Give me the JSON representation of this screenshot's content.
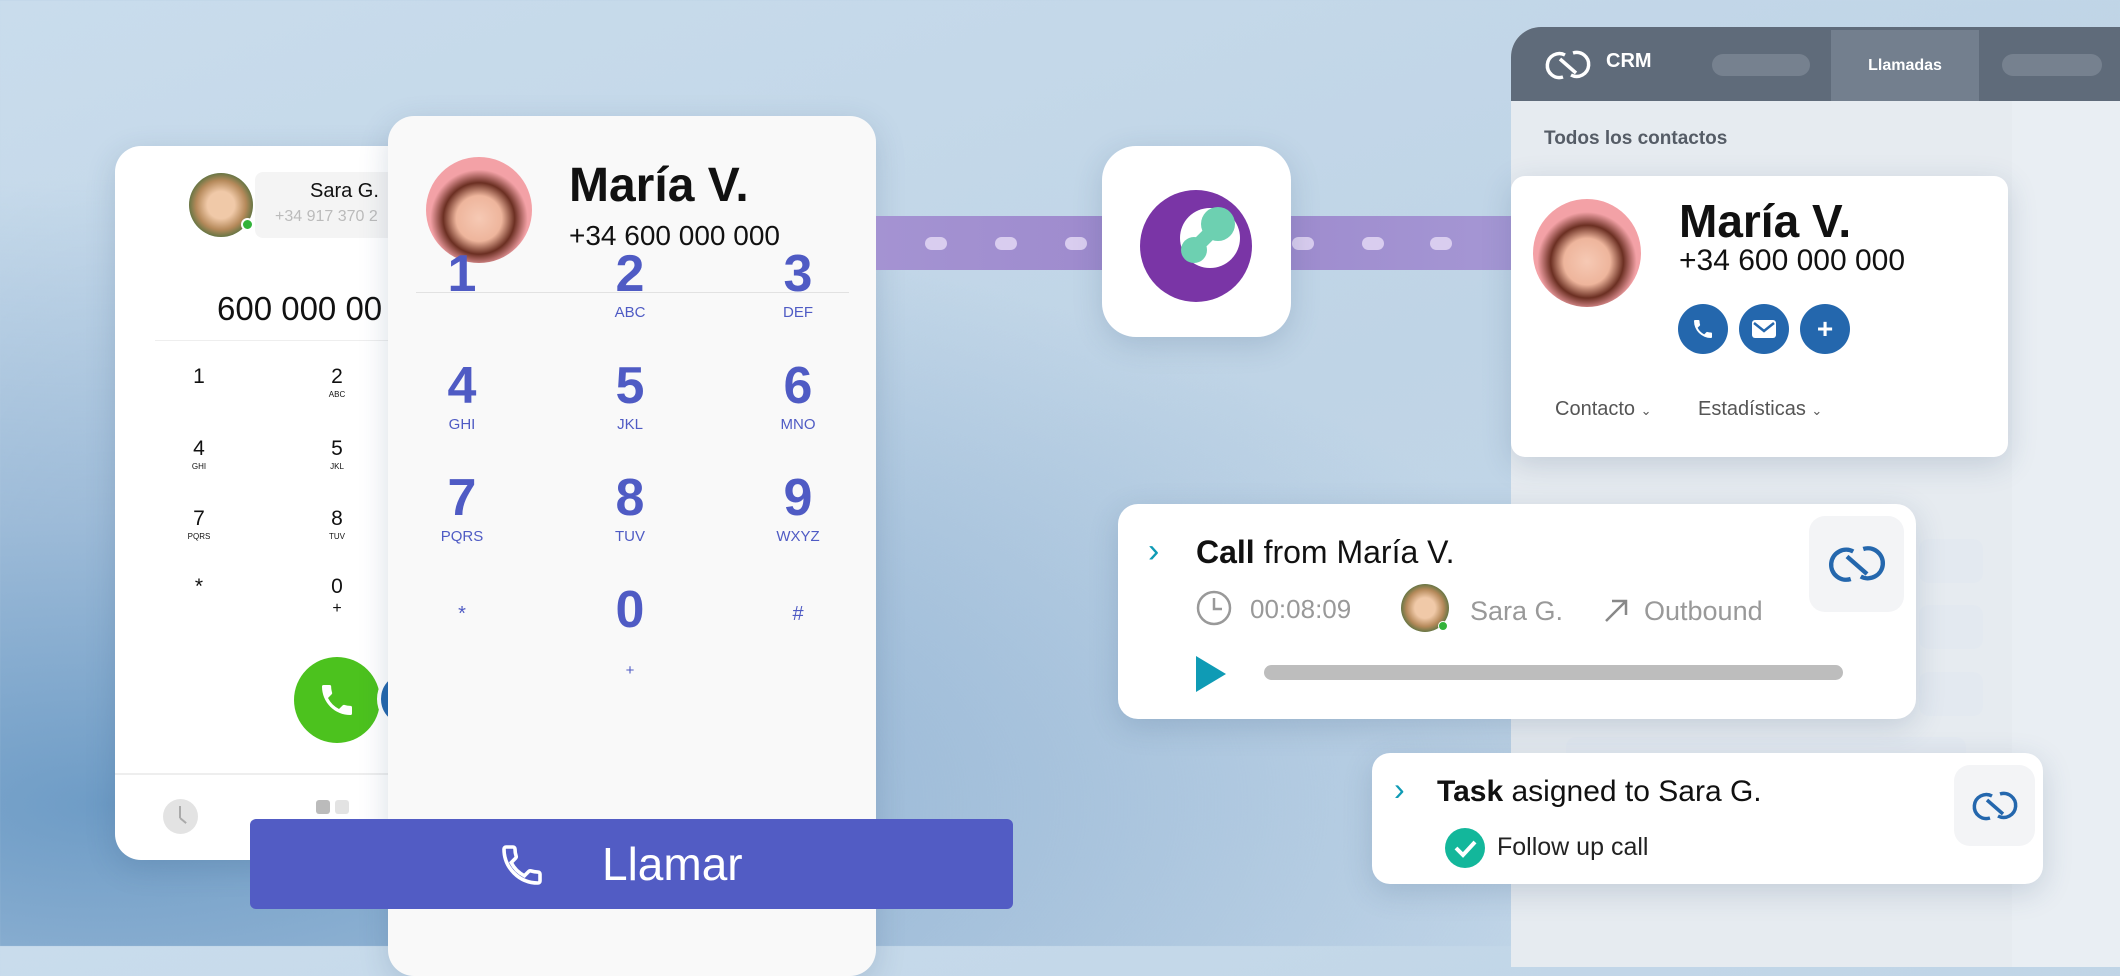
{
  "back_phone": {
    "contact_name": "Sara G.",
    "contact_phone": "+34 917 370 2",
    "dialed_number": "600 000 00",
    "keys": [
      {
        "digit": "1",
        "letters": ""
      },
      {
        "digit": "2",
        "letters": "ABC"
      },
      {
        "digit": "4",
        "letters": "GHI"
      },
      {
        "digit": "5",
        "letters": "JKL"
      },
      {
        "digit": "7",
        "letters": "PQRS"
      },
      {
        "digit": "8",
        "letters": "TUV"
      },
      {
        "digit": "*",
        "letters": ""
      },
      {
        "digit": "0",
        "letters": "+"
      }
    ]
  },
  "dialer": {
    "contact_name": "María V.",
    "contact_phone": "+34 600 000 000",
    "keys": [
      {
        "digit": "1",
        "letters": ""
      },
      {
        "digit": "2",
        "letters": "ABC"
      },
      {
        "digit": "3",
        "letters": "DEF"
      },
      {
        "digit": "4",
        "letters": "GHI"
      },
      {
        "digit": "5",
        "letters": "JKL"
      },
      {
        "digit": "6",
        "letters": "MNO"
      },
      {
        "digit": "7",
        "letters": "PQRS"
      },
      {
        "digit": "8",
        "letters": "TUV"
      },
      {
        "digit": "9",
        "letters": "WXYZ"
      },
      {
        "digit": "*",
        "letters": ""
      },
      {
        "digit": "0",
        "letters": "+"
      },
      {
        "digit": "#",
        "letters": ""
      }
    ],
    "call_button_label": "Llamar"
  },
  "crm": {
    "brand": "CRM",
    "active_tab": "Llamadas",
    "section_title": "Todos los contactos",
    "contact": {
      "name": "María V.",
      "phone": "+34 600 000 000",
      "tabs": [
        "Contacto",
        "Estadísticas"
      ]
    }
  },
  "call_card": {
    "title_bold": "Call",
    "title_rest": " from María V.",
    "duration": "00:08:09",
    "agent": "Sara G.",
    "direction": "Outbound",
    "playback_progress": 0
  },
  "task_card": {
    "title_bold": "Task",
    "title_rest": " asigned to Sara G.",
    "task": "Follow up call",
    "completed": true
  },
  "colors": {
    "dialer_accent": "#4f5bc4",
    "call_green": "#4cc21e",
    "crm_blue": "#2467ad",
    "crm_header": "#5f6b7a",
    "link_purple": "#9c88cc",
    "teal": "#0f9bb5",
    "check_green": "#13b79b"
  }
}
